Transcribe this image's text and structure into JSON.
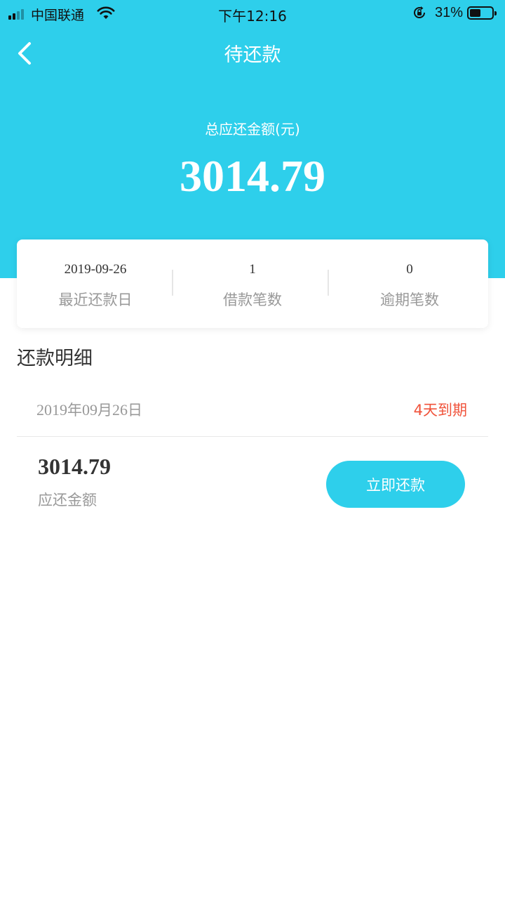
{
  "status_bar": {
    "carrier": "中国联通",
    "time": "下午12:16",
    "battery_percent": "31%",
    "battery_level": 0.31,
    "icons": [
      "signal-icon",
      "wifi-icon",
      "orientation-lock-icon",
      "battery-icon"
    ]
  },
  "nav": {
    "title": "待还款",
    "back_icon": "chevron-left-icon"
  },
  "summary": {
    "total_label": "总应还金额(元)",
    "total_amount": "3014.79",
    "stats": [
      {
        "value": "2019-09-26",
        "label": "最近还款日"
      },
      {
        "value": "1",
        "label": "借款笔数"
      },
      {
        "value": "0",
        "label": "逾期笔数"
      }
    ]
  },
  "details": {
    "section_title": "还款明细",
    "items": [
      {
        "date_year": "2019",
        "date_year_unit": "年",
        "date_month": "09",
        "date_month_unit": "月",
        "date_day": "26",
        "date_day_unit": "日",
        "due_status": "4天到期",
        "amount": "3014.79",
        "amount_label": "应还金额",
        "pay_button": "立即还款"
      }
    ]
  },
  "colors": {
    "accent": "#2ecfeb",
    "warning": "#f0533b",
    "muted_text": "#999999"
  }
}
